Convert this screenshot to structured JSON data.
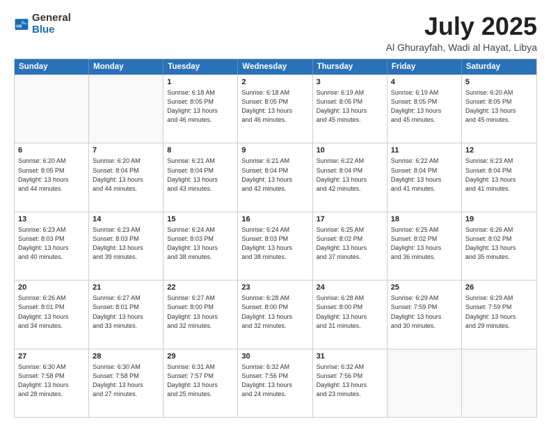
{
  "header": {
    "logo_general": "General",
    "logo_blue": "Blue",
    "title": "July 2025",
    "subtitle": "Al Ghurayfah, Wadi al Hayat, Libya"
  },
  "days_of_week": [
    "Sunday",
    "Monday",
    "Tuesday",
    "Wednesday",
    "Thursday",
    "Friday",
    "Saturday"
  ],
  "weeks": [
    [
      {
        "day": "",
        "sunrise": "",
        "sunset": "",
        "daylight": ""
      },
      {
        "day": "",
        "sunrise": "",
        "sunset": "",
        "daylight": ""
      },
      {
        "day": "1",
        "sunrise": "Sunrise: 6:18 AM",
        "sunset": "Sunset: 8:05 PM",
        "daylight": "Daylight: 13 hours and 46 minutes."
      },
      {
        "day": "2",
        "sunrise": "Sunrise: 6:18 AM",
        "sunset": "Sunset: 8:05 PM",
        "daylight": "Daylight: 13 hours and 46 minutes."
      },
      {
        "day": "3",
        "sunrise": "Sunrise: 6:19 AM",
        "sunset": "Sunset: 8:05 PM",
        "daylight": "Daylight: 13 hours and 45 minutes."
      },
      {
        "day": "4",
        "sunrise": "Sunrise: 6:19 AM",
        "sunset": "Sunset: 8:05 PM",
        "daylight": "Daylight: 13 hours and 45 minutes."
      },
      {
        "day": "5",
        "sunrise": "Sunrise: 6:20 AM",
        "sunset": "Sunset: 8:05 PM",
        "daylight": "Daylight: 13 hours and 45 minutes."
      }
    ],
    [
      {
        "day": "6",
        "sunrise": "Sunrise: 6:20 AM",
        "sunset": "Sunset: 8:05 PM",
        "daylight": "Daylight: 13 hours and 44 minutes."
      },
      {
        "day": "7",
        "sunrise": "Sunrise: 6:20 AM",
        "sunset": "Sunset: 8:04 PM",
        "daylight": "Daylight: 13 hours and 44 minutes."
      },
      {
        "day": "8",
        "sunrise": "Sunrise: 6:21 AM",
        "sunset": "Sunset: 8:04 PM",
        "daylight": "Daylight: 13 hours and 43 minutes."
      },
      {
        "day": "9",
        "sunrise": "Sunrise: 6:21 AM",
        "sunset": "Sunset: 8:04 PM",
        "daylight": "Daylight: 13 hours and 42 minutes."
      },
      {
        "day": "10",
        "sunrise": "Sunrise: 6:22 AM",
        "sunset": "Sunset: 8:04 PM",
        "daylight": "Daylight: 13 hours and 42 minutes."
      },
      {
        "day": "11",
        "sunrise": "Sunrise: 6:22 AM",
        "sunset": "Sunset: 8:04 PM",
        "daylight": "Daylight: 13 hours and 41 minutes."
      },
      {
        "day": "12",
        "sunrise": "Sunrise: 6:23 AM",
        "sunset": "Sunset: 8:04 PM",
        "daylight": "Daylight: 13 hours and 41 minutes."
      }
    ],
    [
      {
        "day": "13",
        "sunrise": "Sunrise: 6:23 AM",
        "sunset": "Sunset: 8:03 PM",
        "daylight": "Daylight: 13 hours and 40 minutes."
      },
      {
        "day": "14",
        "sunrise": "Sunrise: 6:23 AM",
        "sunset": "Sunset: 8:03 PM",
        "daylight": "Daylight: 13 hours and 39 minutes."
      },
      {
        "day": "15",
        "sunrise": "Sunrise: 6:24 AM",
        "sunset": "Sunset: 8:03 PM",
        "daylight": "Daylight: 13 hours and 38 minutes."
      },
      {
        "day": "16",
        "sunrise": "Sunrise: 6:24 AM",
        "sunset": "Sunset: 8:03 PM",
        "daylight": "Daylight: 13 hours and 38 minutes."
      },
      {
        "day": "17",
        "sunrise": "Sunrise: 6:25 AM",
        "sunset": "Sunset: 8:02 PM",
        "daylight": "Daylight: 13 hours and 37 minutes."
      },
      {
        "day": "18",
        "sunrise": "Sunrise: 6:25 AM",
        "sunset": "Sunset: 8:02 PM",
        "daylight": "Daylight: 13 hours and 36 minutes."
      },
      {
        "day": "19",
        "sunrise": "Sunrise: 6:26 AM",
        "sunset": "Sunset: 8:02 PM",
        "daylight": "Daylight: 13 hours and 35 minutes."
      }
    ],
    [
      {
        "day": "20",
        "sunrise": "Sunrise: 6:26 AM",
        "sunset": "Sunset: 8:01 PM",
        "daylight": "Daylight: 13 hours and 34 minutes."
      },
      {
        "day": "21",
        "sunrise": "Sunrise: 6:27 AM",
        "sunset": "Sunset: 8:01 PM",
        "daylight": "Daylight: 13 hours and 33 minutes."
      },
      {
        "day": "22",
        "sunrise": "Sunrise: 6:27 AM",
        "sunset": "Sunset: 8:00 PM",
        "daylight": "Daylight: 13 hours and 32 minutes."
      },
      {
        "day": "23",
        "sunrise": "Sunrise: 6:28 AM",
        "sunset": "Sunset: 8:00 PM",
        "daylight": "Daylight: 13 hours and 32 minutes."
      },
      {
        "day": "24",
        "sunrise": "Sunrise: 6:28 AM",
        "sunset": "Sunset: 8:00 PM",
        "daylight": "Daylight: 13 hours and 31 minutes."
      },
      {
        "day": "25",
        "sunrise": "Sunrise: 6:29 AM",
        "sunset": "Sunset: 7:59 PM",
        "daylight": "Daylight: 13 hours and 30 minutes."
      },
      {
        "day": "26",
        "sunrise": "Sunrise: 6:29 AM",
        "sunset": "Sunset: 7:59 PM",
        "daylight": "Daylight: 13 hours and 29 minutes."
      }
    ],
    [
      {
        "day": "27",
        "sunrise": "Sunrise: 6:30 AM",
        "sunset": "Sunset: 7:58 PM",
        "daylight": "Daylight: 13 hours and 28 minutes."
      },
      {
        "day": "28",
        "sunrise": "Sunrise: 6:30 AM",
        "sunset": "Sunset: 7:58 PM",
        "daylight": "Daylight: 13 hours and 27 minutes."
      },
      {
        "day": "29",
        "sunrise": "Sunrise: 6:31 AM",
        "sunset": "Sunset: 7:57 PM",
        "daylight": "Daylight: 13 hours and 25 minutes."
      },
      {
        "day": "30",
        "sunrise": "Sunrise: 6:32 AM",
        "sunset": "Sunset: 7:56 PM",
        "daylight": "Daylight: 13 hours and 24 minutes."
      },
      {
        "day": "31",
        "sunrise": "Sunrise: 6:32 AM",
        "sunset": "Sunset: 7:56 PM",
        "daylight": "Daylight: 13 hours and 23 minutes."
      },
      {
        "day": "",
        "sunrise": "",
        "sunset": "",
        "daylight": ""
      },
      {
        "day": "",
        "sunrise": "",
        "sunset": "",
        "daylight": ""
      }
    ]
  ]
}
